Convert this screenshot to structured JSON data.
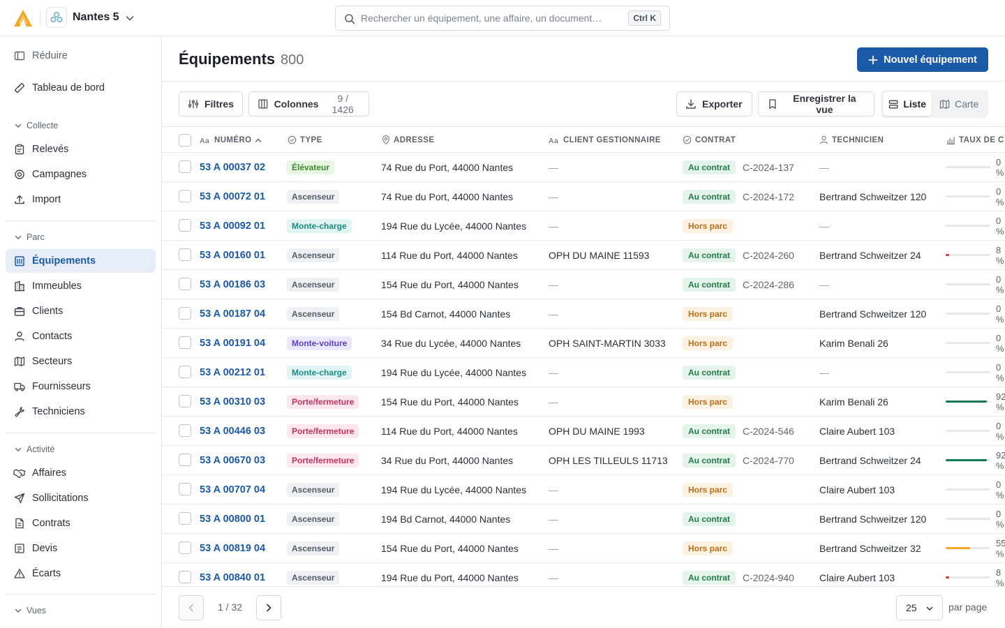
{
  "org": {
    "name": "Nantes 5"
  },
  "search": {
    "placeholder": "Rechercher un équipement, une affaire, un document…",
    "shortcut": "Ctrl K"
  },
  "sidebar": {
    "collapse_label": "Réduire",
    "dashboard_label": "Tableau de bord",
    "sections": {
      "collecte": "Collecte",
      "parc": "Parc",
      "activite": "Activité",
      "vues": "Vues"
    },
    "collecte_items": [
      "Relevés",
      "Campagnes",
      "Import"
    ],
    "parc_items": [
      "Équipements",
      "Immeubles",
      "Clients",
      "Contacts",
      "Secteurs",
      "Fournisseurs",
      "Techniciens"
    ],
    "activite_items": [
      "Affaires",
      "Sollicitations",
      "Contrats",
      "Devis",
      "Écarts"
    ],
    "active_item": "Équipements"
  },
  "header": {
    "title": "Équipements",
    "count": "800",
    "new_button": "Nouvel équipement"
  },
  "toolbar": {
    "filters": "Filtres",
    "columns": "Colonnes",
    "columns_count": "9 / 1426",
    "export": "Exporter",
    "save_view": "Enregistrer la vue",
    "view_list": "Liste",
    "view_map": "Carte",
    "active_view": "Liste"
  },
  "table": {
    "columns": {
      "numero": "NUMÉRO",
      "type": "TYPE",
      "adresse": "ADRESSE",
      "client": "CLIENT GESTIONNAIRE",
      "contrat": "CONTRAT",
      "technicien": "TECHNICIEN",
      "taux": "TAUX DE C"
    },
    "rows": [
      {
        "numero": "53 A 00037 02",
        "type": "Élévateur",
        "adresse": "74 Rue du Port, 44000 Nantes",
        "client": "—",
        "contrat": "Au contrat",
        "contrat_no": "C-2024-137",
        "technicien": "—",
        "taux": 0,
        "taux_label": "0 %"
      },
      {
        "numero": "53 A 00072 01",
        "type": "Ascenseur",
        "adresse": "74 Rue du Port, 44000 Nantes",
        "client": "—",
        "contrat": "Au contrat",
        "contrat_no": "C-2024-172",
        "technicien": "Bertrand Schweitzer 120",
        "taux": 0,
        "taux_label": "0 %"
      },
      {
        "numero": "53 A 00092 01",
        "type": "Monte-charge",
        "adresse": "194 Rue du Lycée, 44000 Nantes",
        "client": "—",
        "contrat": "Hors parc",
        "contrat_no": "",
        "technicien": "—",
        "taux": 0,
        "taux_label": "0 %"
      },
      {
        "numero": "53 A 00160 01",
        "type": "Ascenseur",
        "adresse": "114 Rue du Port, 44000 Nantes",
        "client": "OPH DU MAINE 11593",
        "contrat": "Au contrat",
        "contrat_no": "C-2024-260",
        "technicien": "Bertrand Schweitzer 24",
        "taux": 8,
        "taux_label": "8 %"
      },
      {
        "numero": "53 A 00186 03",
        "type": "Ascenseur",
        "adresse": "154 Rue du Port, 44000 Nantes",
        "client": "—",
        "contrat": "Au contrat",
        "contrat_no": "C-2024-286",
        "technicien": "—",
        "taux": 0,
        "taux_label": "0 %"
      },
      {
        "numero": "53 A 00187 04",
        "type": "Ascenseur",
        "adresse": "154 Bd Carnot, 44000 Nantes",
        "client": "—",
        "contrat": "Hors parc",
        "contrat_no": "",
        "technicien": "Bertrand Schweitzer 120",
        "taux": 0,
        "taux_label": "0 %"
      },
      {
        "numero": "53 A 00191 04",
        "type": "Monte-voiture",
        "adresse": "34 Rue du Lycée, 44000 Nantes",
        "client": "OPH SAINT-MARTIN 3033",
        "contrat": "Hors parc",
        "contrat_no": "",
        "technicien": "Karim Benali 26",
        "taux": 0,
        "taux_label": "0 %"
      },
      {
        "numero": "53 A 00212 01",
        "type": "Monte-charge",
        "adresse": "194 Rue du Lycée, 44000 Nantes",
        "client": "—",
        "contrat": "Au contrat",
        "contrat_no": "",
        "technicien": "—",
        "taux": 0,
        "taux_label": "0 %"
      },
      {
        "numero": "53 A 00310 03",
        "type": "Porte/fermeture",
        "adresse": "154 Rue du Port, 44000 Nantes",
        "client": "—",
        "contrat": "Hors parc",
        "contrat_no": "",
        "technicien": "Karim Benali 26",
        "taux": 92,
        "taux_label": "92 %"
      },
      {
        "numero": "53 A 00446 03",
        "type": "Porte/fermeture",
        "adresse": "114 Rue du Port, 44000 Nantes",
        "client": "OPH DU MAINE 1993",
        "contrat": "Au contrat",
        "contrat_no": "C-2024-546",
        "technicien": "Claire Aubert 103",
        "taux": 0,
        "taux_label": "0 %"
      },
      {
        "numero": "53 A 00670 03",
        "type": "Porte/fermeture",
        "adresse": "34 Rue du Port, 44000 Nantes",
        "client": "OPH LES TILLEULS 11713",
        "contrat": "Au contrat",
        "contrat_no": "C-2024-770",
        "technicien": "Bertrand Schweitzer 24",
        "taux": 92,
        "taux_label": "92 %"
      },
      {
        "numero": "53 A 00707 04",
        "type": "Ascenseur",
        "adresse": "194 Rue du Lycée, 44000 Nantes",
        "client": "—",
        "contrat": "Hors parc",
        "contrat_no": "",
        "technicien": "Claire Aubert 103",
        "taux": 0,
        "taux_label": "0 %"
      },
      {
        "numero": "53 A 00800 01",
        "type": "Ascenseur",
        "adresse": "194 Bd Carnot, 44000 Nantes",
        "client": "—",
        "contrat": "Au contrat",
        "contrat_no": "",
        "technicien": "Bertrand Schweitzer 120",
        "taux": 0,
        "taux_label": "0 %"
      },
      {
        "numero": "53 A 00819 04",
        "type": "Ascenseur",
        "adresse": "154 Rue du Port, 44000 Nantes",
        "client": "—",
        "contrat": "Hors parc",
        "contrat_no": "",
        "technicien": "Bertrand Schweitzer 32",
        "taux": 55,
        "taux_label": "55 %"
      },
      {
        "numero": "53 A 00840 01",
        "type": "Ascenseur",
        "adresse": "194 Rue du Port, 44000 Nantes",
        "client": "—",
        "contrat": "Au contrat",
        "contrat_no": "C-2024-940",
        "technicien": "Claire Aubert 103",
        "taux": 8,
        "taux_label": "8 %"
      }
    ]
  },
  "pagination": {
    "page_text": "1 / 32",
    "per_page_value": "25",
    "per_page_label": "par page"
  },
  "colors": {
    "accent": "#1b5aa6",
    "bar_high": "#157a52",
    "bar_mid": "#f5a623",
    "bar_low": "#d6382c"
  }
}
